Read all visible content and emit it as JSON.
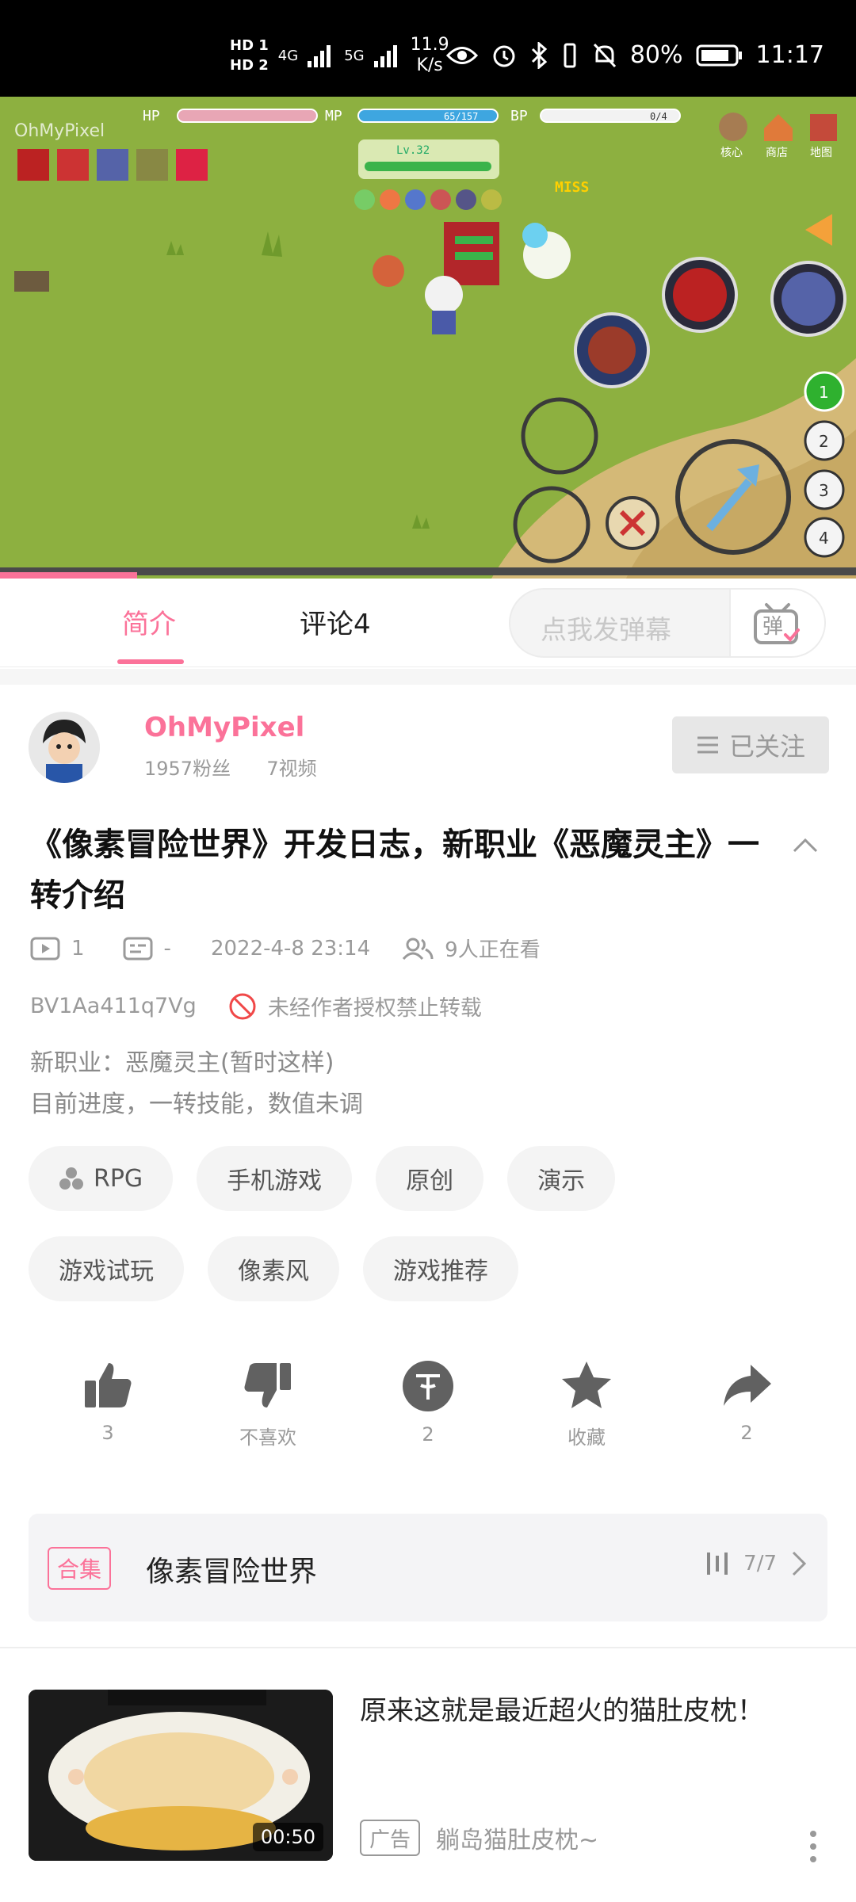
{
  "status_bar": {
    "sim1": "HD 1",
    "sim2": "HD 2",
    "net1": "4G",
    "net2": "5G",
    "speed_value": "11.9",
    "speed_unit": "K/s",
    "battery": "80%",
    "time": "11:17"
  },
  "player": {
    "watermark": "OhMyPixel",
    "hud": {
      "hp_label": "HP",
      "mp_label": "MP",
      "bp_label": "BP",
      "mp_value": "65/157",
      "bp_value": "0/4",
      "menu_core": "核心",
      "menu_shop": "商店",
      "menu_map": "地图",
      "target_level": "Lv.32",
      "miss": "MISS",
      "skill_slots": [
        "1",
        "2",
        "3",
        "4"
      ]
    },
    "progress_fraction": 0.16
  },
  "tabs": [
    {
      "label": "简介",
      "active": true
    },
    {
      "label": "评论4",
      "active": false
    }
  ],
  "danmaku": {
    "placeholder": "点我发弹幕",
    "button": "弹"
  },
  "uploader": {
    "name": "OhMyPixel",
    "fans": "1957粉丝",
    "videos": "7视频",
    "follow_label": "已关注"
  },
  "video": {
    "title": "《像素冒险世界》开发日志，新职业《恶魔灵主》一转介绍",
    "plays": "1",
    "danmaku_count": "-",
    "date": "2022-4-8 23:14",
    "watching": "9人正在看",
    "bvid": "BV1Aa411q7Vg",
    "copyright": "未经作者授权禁止转载",
    "description": [
      "新职业：恶魔灵主(暂时这样)",
      "目前进度，一转技能，数值未调"
    ]
  },
  "tags": [
    [
      "RPG",
      "手机游戏",
      "原创",
      "演示"
    ],
    [
      "游戏试玩",
      "像素风",
      "游戏推荐"
    ]
  ],
  "actions": {
    "like": "3",
    "dislike": "不喜欢",
    "coin": "2",
    "favorite": "收藏",
    "share": "2"
  },
  "collection": {
    "badge": "合集",
    "title": "像素冒险世界",
    "progress": "7/7"
  },
  "recommendation": {
    "title": "原来这就是最近超火的猫肚皮枕！",
    "duration": "00:50",
    "ad_badge": "广告",
    "ad_text": "躺岛猫肚皮枕~"
  },
  "colors": {
    "accent": "#fb7299",
    "grass": "#8db040",
    "path": "#d4b977"
  }
}
